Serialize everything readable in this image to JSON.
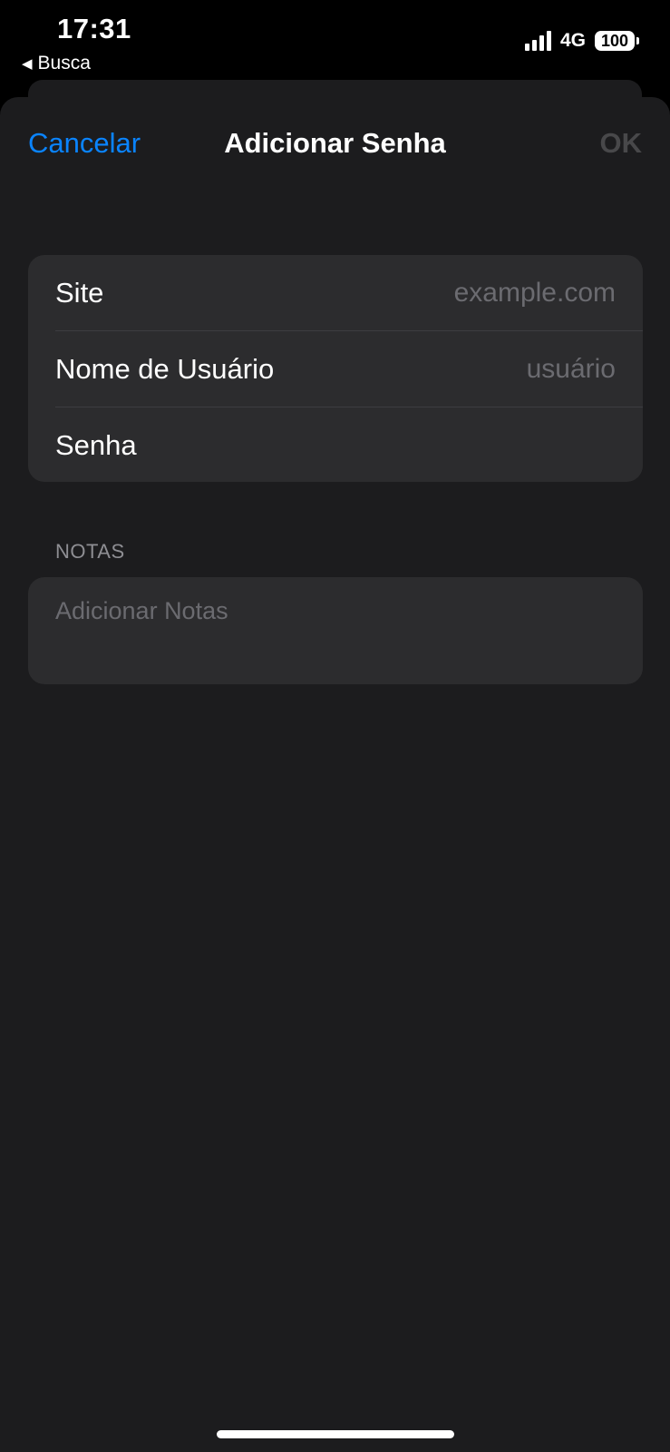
{
  "status_bar": {
    "time": "17:31",
    "back_app": "Busca",
    "back_icon": "back-triangle-icon",
    "network": "4G",
    "battery": "100",
    "signal_icon": "cellular-signal-icon"
  },
  "nav": {
    "cancel_label": "Cancelar",
    "title": "Adicionar Senha",
    "ok_label": "OK"
  },
  "fields": [
    {
      "label": "Site",
      "placeholder": "example.com",
      "value": ""
    },
    {
      "label": "Nome de Usuário",
      "placeholder": "usuário",
      "value": ""
    },
    {
      "label": "Senha",
      "placeholder": "",
      "value": ""
    }
  ],
  "notes": {
    "header": "NOTAS",
    "placeholder": "Adicionar Notas"
  },
  "colors": {
    "accent": "#0a84ff",
    "sheet_bg": "#1c1c1e",
    "group_bg": "#2c2c2e",
    "disabled": "#48484a"
  }
}
